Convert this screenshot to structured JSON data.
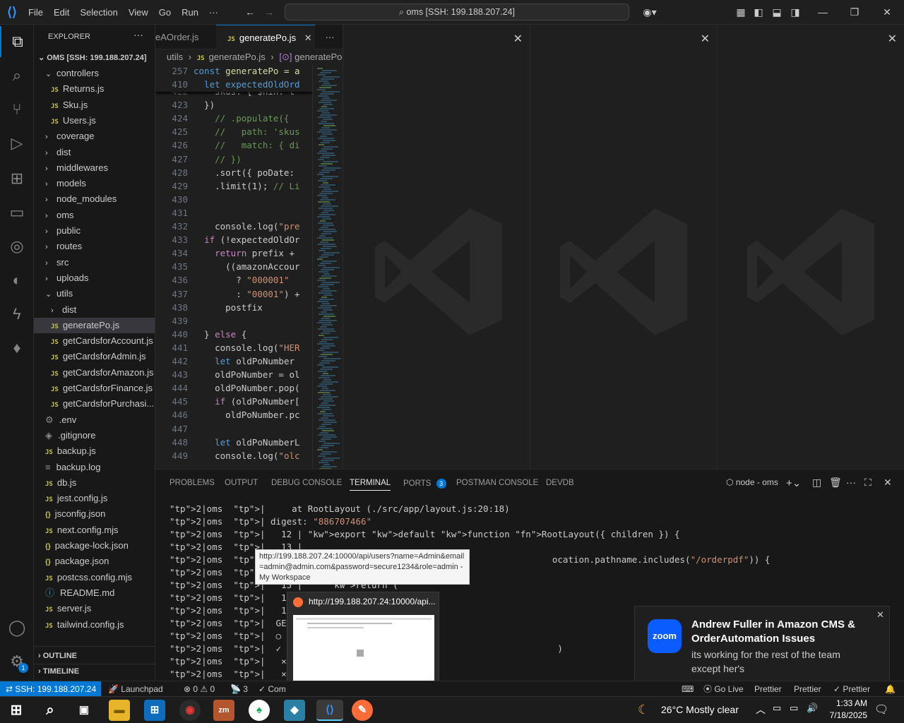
{
  "titlebar": {
    "menu": [
      "File",
      "Edit",
      "Selection",
      "View",
      "Go",
      "Run",
      "···"
    ],
    "command_center": "oms [SSH: 199.188.207.24]"
  },
  "explorer": {
    "title": "EXPLORER",
    "root": "OMS [SSH: 199.188.207.24]",
    "items": [
      {
        "label": "controllers",
        "type": "folder-open",
        "depth": 1
      },
      {
        "label": "Returns.js",
        "type": "js",
        "depth": 2
      },
      {
        "label": "Sku.js",
        "type": "js",
        "depth": 2
      },
      {
        "label": "Users.js",
        "type": "js",
        "depth": 2
      },
      {
        "label": "coverage",
        "type": "folder",
        "depth": 1
      },
      {
        "label": "dist",
        "type": "folder",
        "depth": 1
      },
      {
        "label": "middlewares",
        "type": "folder",
        "depth": 1
      },
      {
        "label": "models",
        "type": "folder",
        "depth": 1
      },
      {
        "label": "node_modules",
        "type": "folder",
        "depth": 1
      },
      {
        "label": "oms",
        "type": "folder",
        "depth": 1
      },
      {
        "label": "public",
        "type": "folder",
        "depth": 1
      },
      {
        "label": "routes",
        "type": "folder",
        "depth": 1
      },
      {
        "label": "src",
        "type": "folder",
        "depth": 1
      },
      {
        "label": "uploads",
        "type": "folder",
        "depth": 1
      },
      {
        "label": "utils",
        "type": "folder-open",
        "depth": 1
      },
      {
        "label": "dist",
        "type": "folder",
        "depth": 2
      },
      {
        "label": "generatePo.js",
        "type": "js",
        "depth": 2
      },
      {
        "label": "getCardsforAccount.js",
        "type": "js",
        "depth": 2
      },
      {
        "label": "getCardsforAdmin.js",
        "type": "js",
        "depth": 2
      },
      {
        "label": "getCardsforAmazon.js",
        "type": "js",
        "depth": 2
      },
      {
        "label": "getCardsforFinance.js",
        "type": "js",
        "depth": 2
      },
      {
        "label": "getCardsforPurchasi...",
        "type": "js",
        "depth": 2
      },
      {
        "label": ".env",
        "type": "gear",
        "depth": 1
      },
      {
        "label": ".gitignore",
        "type": "diamond",
        "depth": 1
      },
      {
        "label": "backup.js",
        "type": "js",
        "depth": 1
      },
      {
        "label": "backup.log",
        "type": "log",
        "depth": 1
      },
      {
        "label": "db.js",
        "type": "js",
        "depth": 1
      },
      {
        "label": "jest.config.js",
        "type": "js",
        "depth": 1
      },
      {
        "label": "jsconfig.json",
        "type": "json",
        "depth": 1
      },
      {
        "label": "next.config.mjs",
        "type": "js",
        "depth": 1
      },
      {
        "label": "package-lock.json",
        "type": "json",
        "depth": 1
      },
      {
        "label": "package.json",
        "type": "json",
        "depth": 1
      },
      {
        "label": "postcss.config.mjs",
        "type": "js",
        "depth": 1
      },
      {
        "label": "README.md",
        "type": "info",
        "depth": 1
      },
      {
        "label": "server.js",
        "type": "js",
        "depth": 1
      },
      {
        "label": "tailwind.config.js",
        "type": "js",
        "depth": 1
      }
    ],
    "outline": "OUTLINE",
    "timeline": "TIMELINE"
  },
  "editor": {
    "tabs": [
      {
        "label": "eAOrder.js",
        "active": false
      },
      {
        "label": "generatePo.js",
        "active": true
      }
    ],
    "breadcrumb": [
      "utils",
      "generatePo.js",
      "generatePo"
    ],
    "sticky": [
      {
        "ln": "257",
        "code": "const generatePo = a"
      },
      {
        "ln": "410",
        "code": "  let expectedOldOrd"
      }
    ],
    "lines": [
      {
        "ln": "422",
        "code": "    skus: { $nin: t"
      },
      {
        "ln": "423",
        "code": "  })"
      },
      {
        "ln": "424",
        "code": "    // .populate({"
      },
      {
        "ln": "425",
        "code": "    //   path: 'skus"
      },
      {
        "ln": "426",
        "code": "    //   match: { di"
      },
      {
        "ln": "427",
        "code": "    // })"
      },
      {
        "ln": "428",
        "code": "    .sort({ poDate: "
      },
      {
        "ln": "429",
        "code": "    .limit(1); // Li"
      },
      {
        "ln": "430",
        "code": ""
      },
      {
        "ln": "431",
        "code": ""
      },
      {
        "ln": "432",
        "code": "    console.log(\"pre"
      },
      {
        "ln": "433",
        "code": "  if (!expectedOldOr"
      },
      {
        "ln": "434",
        "code": "    return prefix +"
      },
      {
        "ln": "435",
        "code": "      ((amazonAccour"
      },
      {
        "ln": "436",
        "code": "        ? \"000001\""
      },
      {
        "ln": "437",
        "code": "        : \"00001\") +"
      },
      {
        "ln": "438",
        "code": "      postfix"
      },
      {
        "ln": "439",
        "code": ""
      },
      {
        "ln": "440",
        "code": "  } else {"
      },
      {
        "ln": "441",
        "code": "    console.log(\"HER"
      },
      {
        "ln": "442",
        "code": "    let oldPoNumber"
      },
      {
        "ln": "443",
        "code": "    oldPoNumber = ol"
      },
      {
        "ln": "444",
        "code": "    oldPoNumber.pop("
      },
      {
        "ln": "445",
        "code": "    if (oldPoNumber["
      },
      {
        "ln": "446",
        "code": "      oldPoNumber.pc"
      },
      {
        "ln": "447",
        "code": ""
      },
      {
        "ln": "448",
        "code": "    let oldPoNumberL"
      },
      {
        "ln": "449",
        "code": "    console.log(\"olc"
      }
    ]
  },
  "panel": {
    "tabs": [
      "PROBLEMS",
      "OUTPUT",
      "DEBUG CONSOLE",
      "TERMINAL",
      "PORTS",
      "POSTMAN CONSOLE",
      "DEVDB"
    ],
    "ports_count": "3",
    "terminal_name": "node - oms",
    "terminal_lines": [
      "2|oms  |     at RootLayout (./src/app/layout.js:20:18)",
      "2|oms  | digest: \"886707466\"",
      "2|oms  |   12 | export default function RootLayout({ children }) {",
      "2|oms  |   13 |",
      "2|oms  | > 14 |                                               ocation.pathname.includes(\"/orderpdf\")) {",
      "2|oms  |      |",
      "2|oms  |   15 |     return (",
      "2|oms  |   16 |       <h",
      "2|oms  |   17 |         <",
      "2|oms  |  GET /login 500",
      "2|oms  |  ○ Compiling /_",
      "2|oms  |  ✓ Compiled /_n                                       )",
      "2|oms  |   × src/app/layo",
      "2|oms  |   × ReferenceErr"
    ]
  },
  "tooltip": {
    "text": "http://199.188.207.24:10000/api/users?name=Admin&email=admin@admin.com&password=secure1234&role=admin - My Workspace"
  },
  "preview": {
    "title": "http://199.188.207.24:10000/api..."
  },
  "toast": {
    "title": "Andrew Fuller in Amazon CMS & OrderAutomation Issues",
    "message": "its working for the rest of the team except her's",
    "app": "zoom"
  },
  "statusbar": {
    "remote": "SSH: 199.188.207.24",
    "launchpad": "Launchpad",
    "errors": "0",
    "warnings": "0",
    "ports": "3",
    "right": [
      "Go Live",
      "Prettier",
      "Prettier",
      "Prettier"
    ],
    "compiling": "Com"
  },
  "taskbar": {
    "weather": "26°C  Mostly clear",
    "time": "1:33 AM",
    "date": "7/18/2025"
  },
  "activity_badges": {
    "settings": "1"
  }
}
